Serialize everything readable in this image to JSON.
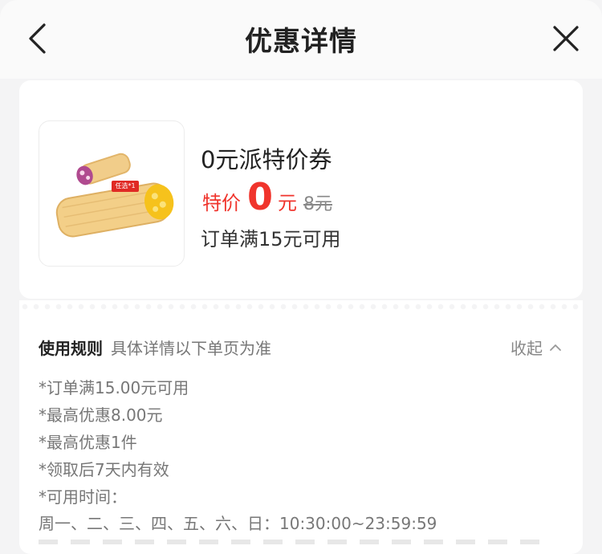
{
  "header": {
    "title": "优惠详情",
    "back_icon": "chevron-left-icon",
    "close_icon": "close-icon"
  },
  "coupon": {
    "name": "0元派特价券",
    "price_label": "特价",
    "price_value": "0",
    "price_unit": "元",
    "original_price": "8元",
    "condition": "订单满15元可用",
    "image_badge": "任选*1"
  },
  "rules": {
    "title": "使用规则",
    "subtitle": "具体详情以下单页为准",
    "collapse_label": "收起",
    "items": [
      "*订单满15.00元可用",
      "*最高优惠8.00元",
      "*最高优惠1件",
      "*领取后7天内有效",
      "*可用时间："
    ],
    "time_range": "周一、二、三、四、五、六、日：10:30:00~23:59:59"
  },
  "colors": {
    "accent": "#f0342c",
    "background": "#f4f4f5",
    "card": "#ffffff"
  }
}
